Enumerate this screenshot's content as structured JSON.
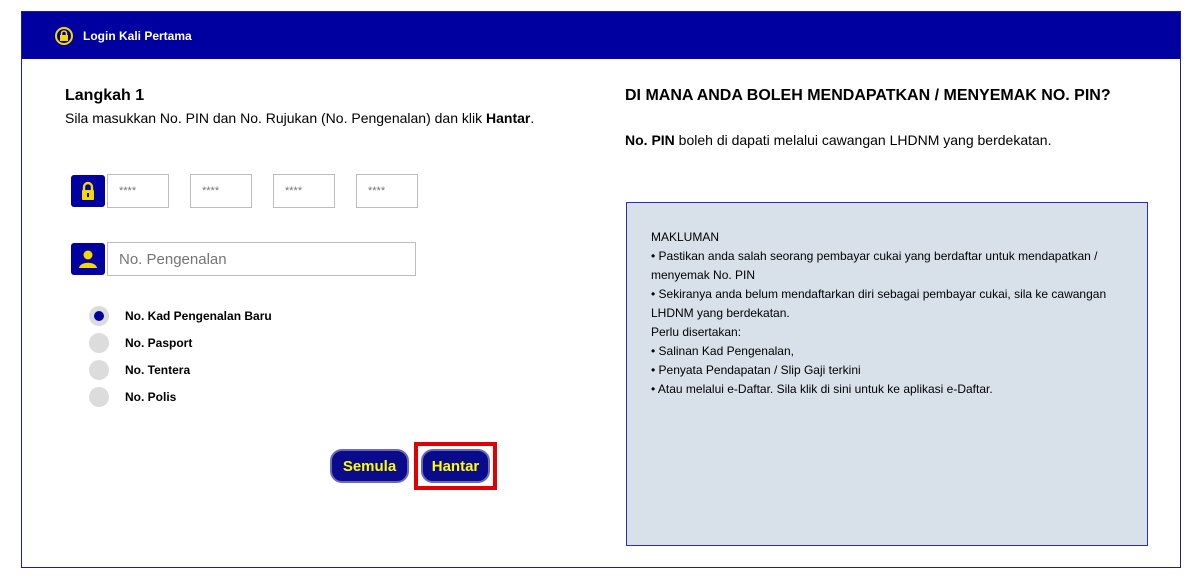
{
  "header": {
    "title": "Login Kali Pertama",
    "colors": {
      "bar": "#0000a0",
      "icon": "#f5d800"
    }
  },
  "step": {
    "title": "Langkah 1",
    "desc_pre": "Sila masukkan No. PIN dan No. Rujukan (No. Pengenalan) dan klik ",
    "desc_bold": "Hantar",
    "desc_post": "."
  },
  "pin": {
    "placeholders": [
      "****",
      "****",
      "****",
      "****"
    ]
  },
  "id_field": {
    "placeholder": "No. Pengenalan"
  },
  "id_types": [
    {
      "label": "No. Kad Pengenalan Baru",
      "selected": true
    },
    {
      "label": "No. Pasport",
      "selected": false
    },
    {
      "label": "No. Tentera",
      "selected": false
    },
    {
      "label": "No. Polis",
      "selected": false
    }
  ],
  "buttons": {
    "reset": "Semula",
    "submit": "Hantar"
  },
  "info": {
    "title": "DI MANA ANDA BOLEH MENDAPATKAN / MENYEMAK NO. PIN?",
    "sub_bold": "No. PIN",
    "sub_rest": " boleh di dapati melalui cawangan LHDNM yang berdekatan.",
    "box": {
      "heading": "MAKLUMAN",
      "bullet1": "• Pastikan anda salah seorang pembayar cukai yang berdaftar untuk mendapatkan / menyemak No. PIN",
      "bullet2": "• Sekiranya anda belum mendaftarkan diri sebagai pembayar cukai, sila ke cawangan LHDNM yang berdekatan.",
      "attach_label": "Perlu disertakan:",
      "attach1": "• Salinan Kad Pengenalan,",
      "attach2": "• Penyata Pendapatan / Slip Gaji terkini",
      "bullet3": "• Atau melalui e-Daftar. Sila klik di sini untuk ke aplikasi e-Daftar."
    }
  }
}
